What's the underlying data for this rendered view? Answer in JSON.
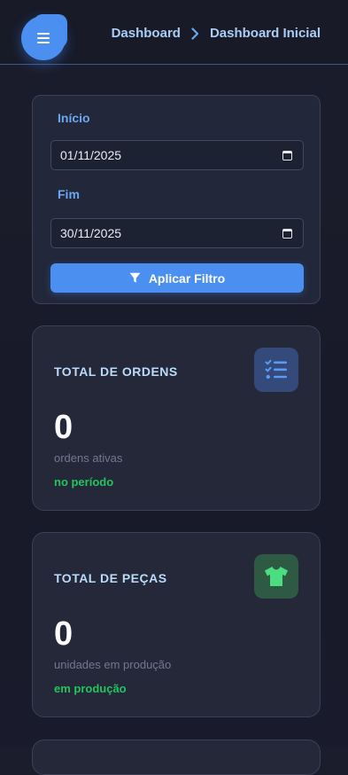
{
  "header": {
    "breadcrumb": [
      "Dashboard",
      "Dashboard Inicial"
    ]
  },
  "filter": {
    "start_label": "Início",
    "start_value": "01/11/2025",
    "end_label": "Fim",
    "end_value": "30/11/2025",
    "apply_label": "Aplicar Filtro"
  },
  "cards": [
    {
      "title": "TOTAL DE ORDENS",
      "value": "0",
      "subtitle": "ordens ativas",
      "note": "no período",
      "icon": "list-check-icon",
      "icon_color": "#5b9cf2",
      "icon_bg": "#334a7a"
    },
    {
      "title": "TOTAL DE PEÇAS",
      "value": "0",
      "subtitle": "unidades em produção",
      "note": "em produção",
      "icon": "shirt-icon",
      "icon_color": "#4ade80",
      "icon_bg": "#2e5a44"
    }
  ],
  "colors": {
    "accent": "#4b8ff0",
    "success": "#22c55e",
    "label_blue": "#6aa8f0"
  }
}
